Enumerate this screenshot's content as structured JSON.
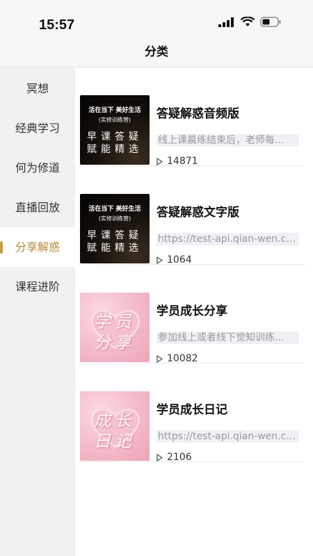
{
  "status": {
    "time": "15:57"
  },
  "header": {
    "title": "分类"
  },
  "sidebar": {
    "items": [
      {
        "label": "冥想",
        "active": false
      },
      {
        "label": "经典学习",
        "active": false
      },
      {
        "label": "何为修道",
        "active": false
      },
      {
        "label": "直播回放",
        "active": false
      },
      {
        "label": "分享解惑",
        "active": true
      },
      {
        "label": "课程进阶",
        "active": false
      }
    ]
  },
  "cards": [
    {
      "title": "答疑解惑音频版",
      "desc": "线上课晨练结束后，老师每...",
      "plays": "14871",
      "thumb": {
        "line1": "活在当下 美好生活",
        "line2": "(实修训练营)",
        "line3": "早课答疑",
        "line4": "赋能精选"
      }
    },
    {
      "title": "答疑解惑文字版",
      "desc": "https://test-api.qian-wen.cn/...",
      "plays": "1064",
      "thumb": {
        "line1": "活在当下 美好生活",
        "line2": "(实修训练营)",
        "line3": "早课答疑",
        "line4": "赋能精选"
      }
    },
    {
      "title": "学员成长分享",
      "desc": "参加线上或者线下觉知训练...",
      "plays": "10082",
      "thumb": {
        "line1": "学员",
        "line2": "分享"
      }
    },
    {
      "title": "学员成长日记",
      "desc": "https://test-api.qian-wen.cn/...",
      "plays": "2106",
      "thumb": {
        "line1": "成长",
        "line2": "日记"
      }
    }
  ]
}
